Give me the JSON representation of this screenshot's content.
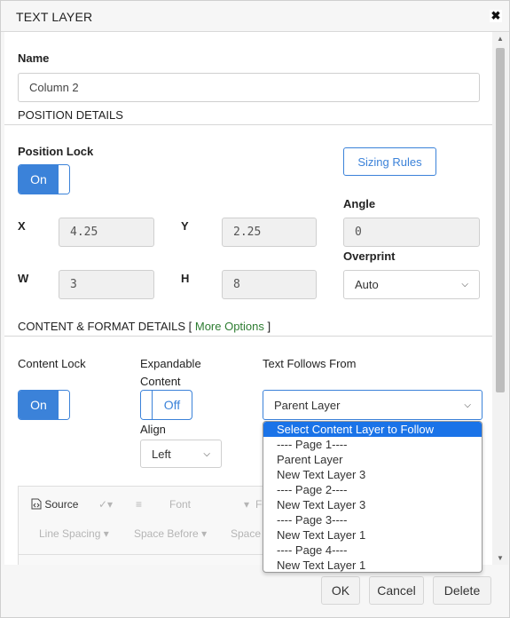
{
  "dialog": {
    "title": "TEXT LAYER",
    "close_icon": "✖"
  },
  "name_field": {
    "label": "Name",
    "value": "Column 2"
  },
  "position": {
    "section_title": "POSITION DETAILS",
    "lock_label": "Position Lock",
    "lock_value": "On",
    "sizing_rules": "Sizing Rules",
    "angle_label": "Angle",
    "angle_value": "0",
    "x_label": "X",
    "x_value": "4.25",
    "y_label": "Y",
    "y_value": "2.25",
    "w_label": "W",
    "w_value": "3",
    "h_label": "H",
    "h_value": "8",
    "overprint_label": "Overprint",
    "overprint_value": "Auto"
  },
  "content": {
    "section_title_prefix": "CONTENT & FORMAT DETAILS [",
    "more_options": "More Options",
    "section_title_suffix": "]",
    "lock_label": "Content Lock",
    "lock_value": "On",
    "expandable_label_1": "Expandable",
    "expandable_label_2": "Content",
    "expandable_value": "Off",
    "follows_label": "Text Follows From",
    "follows_value": "Parent Layer",
    "align_label": "Align",
    "align_value": "Left"
  },
  "editor_toolbar": {
    "source": "Source",
    "font": "Font",
    "font_trunc": "Fo",
    "line_spacing": "Line Spacing",
    "space_before": "Space Before",
    "space_after_trunc": "Space A"
  },
  "dropdown_options": [
    "Select Content Layer to Follow",
    "---- Page 1----",
    "Parent Layer",
    "New Text Layer 3",
    "---- Page 2----",
    "New Text Layer 3",
    "---- Page 3----",
    "New Text Layer 1",
    "---- Page 4----",
    "New Text Layer 1"
  ],
  "footer": {
    "ok": "OK",
    "cancel": "Cancel",
    "delete": "Delete"
  },
  "colors": {
    "accent": "#3b82d9",
    "link": "#2e7d32",
    "selected": "#1a73e8"
  }
}
